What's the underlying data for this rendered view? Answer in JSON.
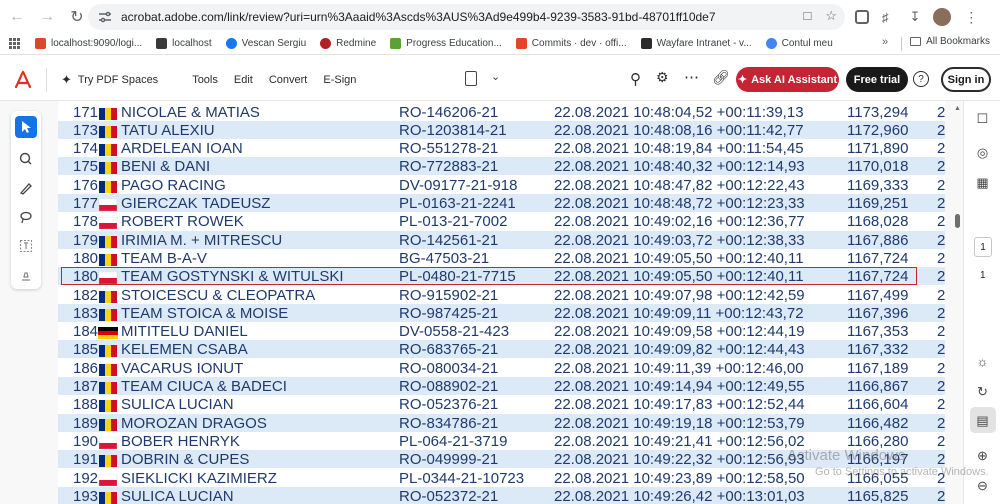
{
  "browser": {
    "url": "acrobat.adobe.com/link/review?uri=urn%3Aaaid%3Ascds%3AUS%3Ad9e499b4-9239-3583-91bd-48701ff10de7",
    "bookmarks": [
      {
        "label": "localhost:9090/logi...",
        "color": "#d9482b"
      },
      {
        "label": "localhost",
        "color": "#3a3a3a"
      },
      {
        "label": "Vescan Sergiu",
        "color": "#1877f2"
      },
      {
        "label": "Redmine",
        "color": "#b32024"
      },
      {
        "label": "Progress Education...",
        "color": "#5ca038"
      },
      {
        "label": "Commits · dev · offi...",
        "color": "#e24329"
      },
      {
        "label": "Wayfare Intranet - v...",
        "color": "#2b2b2b"
      },
      {
        "label": "Contul meu",
        "color": "#4285f4"
      }
    ],
    "all_bookmarks_label": "All Bookmarks"
  },
  "acrobat": {
    "try_label": "Try PDF Spaces",
    "menu": [
      "Tools",
      "Edit",
      "Convert",
      "E-Sign"
    ],
    "ai_label": "Ask AI Assistant",
    "trial_label": "Free trial",
    "help_label": "?",
    "signin_label": "Sign in"
  },
  "rows": [
    {
      "num": "171",
      "flag": "RO",
      "name": "NICOLAE & MATIAS",
      "ring": "RO-146206-21",
      "datetime": "22.08.2021 10:48:04,52 +00:11:39,13",
      "speed": "1173,294",
      "extra": "2"
    },
    {
      "num": "173",
      "flag": "RO",
      "name": "TATU ALEXIU",
      "ring": "RO-1203814-21",
      "datetime": "22.08.2021 10:48:08,16 +00:11:42,77",
      "speed": "1172,960",
      "extra": "2"
    },
    {
      "num": "174",
      "flag": "RO",
      "name": "ARDELEAN IOAN",
      "ring": "RO-551278-21",
      "datetime": "22.08.2021 10:48:19,84 +00:11:54,45",
      "speed": "1171,890",
      "extra": "2"
    },
    {
      "num": "175",
      "flag": "RO",
      "name": "BENI & DANI",
      "ring": "RO-772883-21",
      "datetime": "22.08.2021 10:48:40,32 +00:12:14,93",
      "speed": "1170,018",
      "extra": "2"
    },
    {
      "num": "176",
      "flag": "RO",
      "name": "PAGO RACING",
      "ring": "DV-09177-21-918",
      "datetime": "22.08.2021 10:48:47,82 +00:12:22,43",
      "speed": "1169,333",
      "extra": "2"
    },
    {
      "num": "177",
      "flag": "PL",
      "name": "GIERCZAK TADEUSZ",
      "ring": "PL-0163-21-2241",
      "datetime": "22.08.2021 10:48:48,72 +00:12:23,33",
      "speed": "1169,251",
      "extra": "2"
    },
    {
      "num": "178",
      "flag": "PL",
      "name": "ROBERT ROWEK",
      "ring": "PL-013-21-7002",
      "datetime": "22.08.2021 10:49:02,16 +00:12:36,77",
      "speed": "1168,028",
      "extra": "2"
    },
    {
      "num": "179",
      "flag": "RO",
      "name": "IRIMIA M. + MITRESCU",
      "ring": "RO-142561-21",
      "datetime": "22.08.2021 10:49:03,72 +00:12:38,33",
      "speed": "1167,886",
      "extra": "2"
    },
    {
      "num": "180",
      "flag": "RO",
      "name": "TEAM B-A-V",
      "ring": "BG-47503-21",
      "datetime": "22.08.2021 10:49:05,50 +00:12:40,11",
      "speed": "1167,724",
      "extra": "2"
    },
    {
      "num": "180",
      "flag": "PL",
      "name": "TEAM GOSTYNSKI & WITULSKI",
      "ring": "PL-0480-21-7715",
      "datetime": "22.08.2021 10:49:05,50 +00:12:40,11",
      "speed": "1167,724",
      "extra": "2"
    },
    {
      "num": "182",
      "flag": "RO",
      "name": "STOICESCU & CLEOPATRA",
      "ring": "RO-915902-21",
      "datetime": "22.08.2021 10:49:07,98 +00:12:42,59",
      "speed": "1167,499",
      "extra": "2"
    },
    {
      "num": "183",
      "flag": "RO",
      "name": "TEAM STOICA & MOISE",
      "ring": "RO-987425-21",
      "datetime": "22.08.2021 10:49:09,11 +00:12:43,72",
      "speed": "1167,396",
      "extra": "2"
    },
    {
      "num": "184",
      "flag": "DE",
      "name": "MITITELU DANIEL",
      "ring": "DV-0558-21-423",
      "datetime": "22.08.2021 10:49:09,58 +00:12:44,19",
      "speed": "1167,353",
      "extra": "2"
    },
    {
      "num": "185",
      "flag": "RO",
      "name": "KELEMEN CSABA",
      "ring": "RO-683765-21",
      "datetime": "22.08.2021 10:49:09,82 +00:12:44,43",
      "speed": "1167,332",
      "extra": "2"
    },
    {
      "num": "186",
      "flag": "RO",
      "name": "VACARUS IONUT",
      "ring": "RO-080034-21",
      "datetime": "22.08.2021 10:49:11,39 +00:12:46,00",
      "speed": "1167,189",
      "extra": "2"
    },
    {
      "num": "187",
      "flag": "RO",
      "name": "TEAM CIUCA & BADECI",
      "ring": "RO-088902-21",
      "datetime": "22.08.2021 10:49:14,94 +00:12:49,55",
      "speed": "1166,867",
      "extra": "2"
    },
    {
      "num": "188",
      "flag": "RO",
      "name": "SULICA LUCIAN",
      "ring": "RO-052376-21",
      "datetime": "22.08.2021 10:49:17,83 +00:12:52,44",
      "speed": "1166,604",
      "extra": "2"
    },
    {
      "num": "189",
      "flag": "RO",
      "name": "MOROZAN DRAGOS",
      "ring": "RO-834786-21",
      "datetime": "22.08.2021 10:49:19,18 +00:12:53,79",
      "speed": "1166,482",
      "extra": "2"
    },
    {
      "num": "190",
      "flag": "PL",
      "name": "BOBER HENRYK",
      "ring": "PL-064-21-3719",
      "datetime": "22.08.2021 10:49:21,41 +00:12:56,02",
      "speed": "1166,280",
      "extra": "2"
    },
    {
      "num": "191",
      "flag": "RO",
      "name": "DOBRIN & CUPES",
      "ring": "RO-049999-21",
      "datetime": "22.08.2021 10:49:22,32 +00:12:56,93",
      "speed": "1166,197",
      "extra": "2"
    },
    {
      "num": "192",
      "flag": "PL",
      "name": "SIEKLICKI KAZIMIERZ",
      "ring": "PL-0344-21-10723",
      "datetime": "22.08.2021 10:49:23,89 +00:12:58,50",
      "speed": "1166,055",
      "extra": "2"
    },
    {
      "num": "193",
      "flag": "RO",
      "name": "SULICA LUCIAN",
      "ring": "RO-052372-21",
      "datetime": "22.08.2021 10:49:26,42 +00:13:01,03",
      "speed": "1165,825",
      "extra": "2"
    }
  ],
  "right_rail": {
    "page_current": "1",
    "page_total": "1"
  },
  "watermark": {
    "line1": "Activate Windows",
    "line2": "Go to Settings to activate Windows."
  },
  "colors": {
    "accent": "#1473e6",
    "ai_button": "#c42434",
    "highlight_box": "#c1272d",
    "row_alt": "#dce9f6",
    "text": "#1f3a6e"
  }
}
